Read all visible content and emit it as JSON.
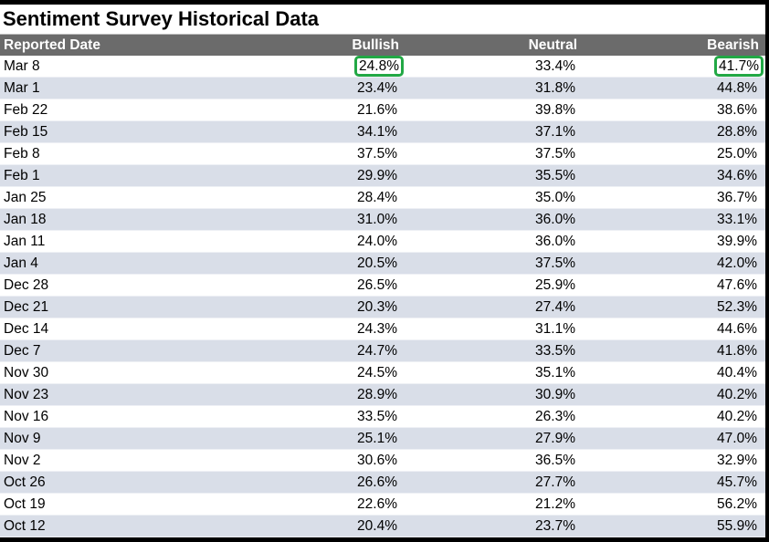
{
  "title": "Sentiment Survey Historical Data",
  "colors": {
    "header_bg": "#6b6b6b",
    "alt_row_bg": "#d9dee8",
    "highlight": "#22a845"
  },
  "columns": [
    "Reported Date",
    "Bullish",
    "Neutral",
    "Bearish"
  ],
  "highlighted_cells": [
    {
      "row": 0,
      "column": "Bullish"
    },
    {
      "row": 0,
      "column": "Bearish"
    }
  ],
  "rows": [
    {
      "date": "Mar 8",
      "bullish": "24.8%",
      "neutral": "33.4%",
      "bearish": "41.7%"
    },
    {
      "date": "Mar 1",
      "bullish": "23.4%",
      "neutral": "31.8%",
      "bearish": "44.8%"
    },
    {
      "date": "Feb 22",
      "bullish": "21.6%",
      "neutral": "39.8%",
      "bearish": "38.6%"
    },
    {
      "date": "Feb 15",
      "bullish": "34.1%",
      "neutral": "37.1%",
      "bearish": "28.8%"
    },
    {
      "date": "Feb 8",
      "bullish": "37.5%",
      "neutral": "37.5%",
      "bearish": "25.0%"
    },
    {
      "date": "Feb 1",
      "bullish": "29.9%",
      "neutral": "35.5%",
      "bearish": "34.6%"
    },
    {
      "date": "Jan 25",
      "bullish": "28.4%",
      "neutral": "35.0%",
      "bearish": "36.7%"
    },
    {
      "date": "Jan 18",
      "bullish": "31.0%",
      "neutral": "36.0%",
      "bearish": "33.1%"
    },
    {
      "date": "Jan 11",
      "bullish": "24.0%",
      "neutral": "36.0%",
      "bearish": "39.9%"
    },
    {
      "date": "Jan 4",
      "bullish": "20.5%",
      "neutral": "37.5%",
      "bearish": "42.0%"
    },
    {
      "date": "Dec 28",
      "bullish": "26.5%",
      "neutral": "25.9%",
      "bearish": "47.6%"
    },
    {
      "date": "Dec 21",
      "bullish": "20.3%",
      "neutral": "27.4%",
      "bearish": "52.3%"
    },
    {
      "date": "Dec 14",
      "bullish": "24.3%",
      "neutral": "31.1%",
      "bearish": "44.6%"
    },
    {
      "date": "Dec 7",
      "bullish": "24.7%",
      "neutral": "33.5%",
      "bearish": "41.8%"
    },
    {
      "date": "Nov 30",
      "bullish": "24.5%",
      "neutral": "35.1%",
      "bearish": "40.4%"
    },
    {
      "date": "Nov 23",
      "bullish": "28.9%",
      "neutral": "30.9%",
      "bearish": "40.2%"
    },
    {
      "date": "Nov 16",
      "bullish": "33.5%",
      "neutral": "26.3%",
      "bearish": "40.2%"
    },
    {
      "date": "Nov 9",
      "bullish": "25.1%",
      "neutral": "27.9%",
      "bearish": "47.0%"
    },
    {
      "date": "Nov 2",
      "bullish": "30.6%",
      "neutral": "36.5%",
      "bearish": "32.9%"
    },
    {
      "date": "Oct 26",
      "bullish": "26.6%",
      "neutral": "27.7%",
      "bearish": "45.7%"
    },
    {
      "date": "Oct 19",
      "bullish": "22.6%",
      "neutral": "21.2%",
      "bearish": "56.2%"
    },
    {
      "date": "Oct 12",
      "bullish": "20.4%",
      "neutral": "23.7%",
      "bearish": "55.9%"
    }
  ]
}
